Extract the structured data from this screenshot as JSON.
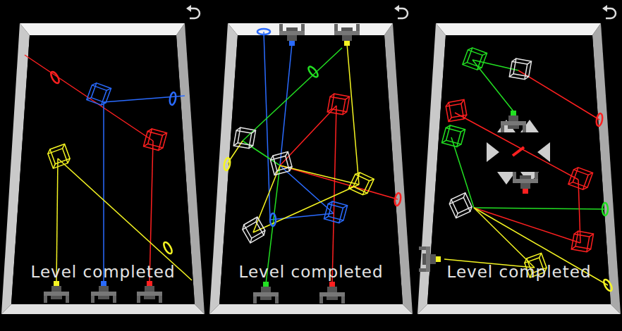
{
  "panels": [
    {
      "status": "Level completed",
      "lasers": [
        {
          "color": "#ff2020"
        },
        {
          "color": "#2a6bff"
        },
        {
          "color": "#f5f522"
        }
      ]
    },
    {
      "status": "Level completed",
      "lasers": [
        {
          "color": "#ff2020"
        },
        {
          "color": "#22e022"
        },
        {
          "color": "#2a6bff"
        },
        {
          "color": "#f5f522"
        }
      ]
    },
    {
      "status": "Level completed",
      "lasers": [
        {
          "color": "#ff2020"
        },
        {
          "color": "#22e022"
        },
        {
          "color": "#f5f522"
        }
      ]
    }
  ]
}
